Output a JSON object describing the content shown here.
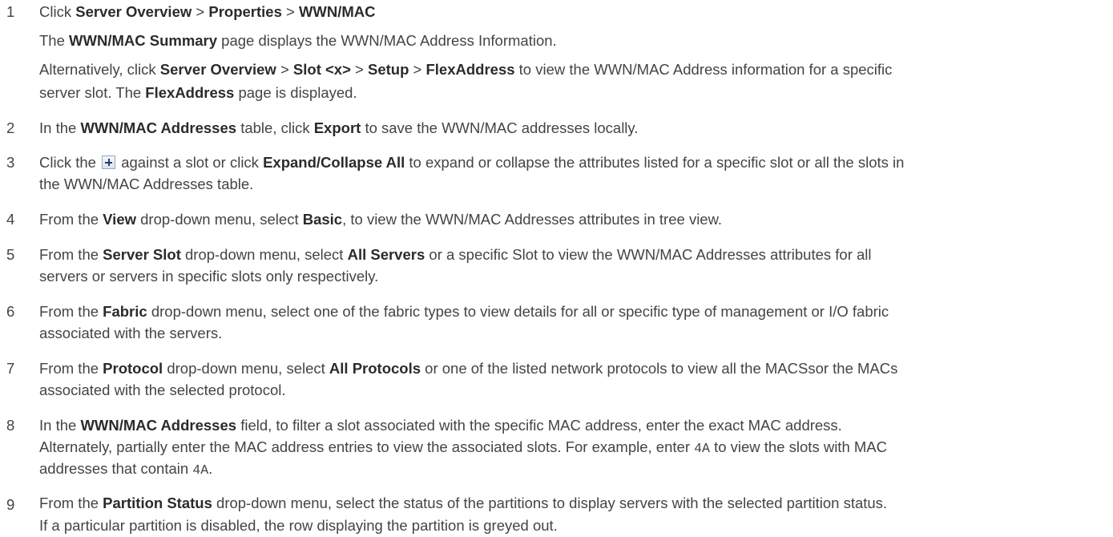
{
  "steps": [
    {
      "num": "1",
      "lines": [
        [
          {
            "t": "Click "
          },
          {
            "b": "Server Overview"
          },
          {
            "t": " > "
          },
          {
            "b": "Properties"
          },
          {
            "t": " > "
          },
          {
            "b": "WWN/MAC"
          }
        ],
        [
          {
            "t": "The "
          },
          {
            "b": "WWN/MAC Summary"
          },
          {
            "t": " page displays the WWN/MAC Address Information."
          }
        ],
        [
          {
            "t": "Alternatively, click "
          },
          {
            "b": "Server Overview"
          },
          {
            "t": " > "
          },
          {
            "b": "Slot <x>"
          },
          {
            "t": " > "
          },
          {
            "b": "Setup"
          },
          {
            "t": " > "
          },
          {
            "b": "FlexAddress"
          },
          {
            "t": " to view the WWN/MAC Address information for a specific"
          }
        ],
        [
          {
            "t": "server slot. The "
          },
          {
            "b": "FlexAddress"
          },
          {
            "t": " page is displayed."
          }
        ]
      ]
    },
    {
      "num": "2",
      "lines": [
        [
          {
            "t": "In the "
          },
          {
            "b": "WWN/MAC Addresses"
          },
          {
            "t": " table, click "
          },
          {
            "b": "Export"
          },
          {
            "t": " to save the WWN/MAC addresses locally."
          }
        ]
      ]
    },
    {
      "num": "3",
      "lines": [
        [
          {
            "t": "Click the "
          },
          {
            "icon": "plus-icon"
          },
          {
            "t": " against a slot or click "
          },
          {
            "b": "Expand/Collapse All"
          },
          {
            "t": " to expand or collapse the attributes listed for a specific slot or all the slots in"
          }
        ],
        [
          {
            "t": "the WWN/MAC Addresses table."
          }
        ]
      ]
    },
    {
      "num": "4",
      "lines": [
        [
          {
            "t": "From the "
          },
          {
            "b": "View"
          },
          {
            "t": " drop-down menu, select "
          },
          {
            "b": "Basic"
          },
          {
            "t": ", to view the WWN/MAC Addresses attributes in tree view."
          }
        ]
      ]
    },
    {
      "num": "5",
      "lines": [
        [
          {
            "t": "From the "
          },
          {
            "b": "Server Slot"
          },
          {
            "t": " drop-down menu, select "
          },
          {
            "b": "All Servers"
          },
          {
            "t": " or a specific Slot to view the WWN/MAC Addresses attributes for all"
          }
        ],
        [
          {
            "t": "servers or servers in specific slots only respectively."
          }
        ]
      ]
    },
    {
      "num": "6",
      "lines": [
        [
          {
            "t": "From the "
          },
          {
            "b": "Fabric"
          },
          {
            "t": " drop-down menu, select one of the fabric types to view details for all or specific type of management or I/O fabric"
          }
        ],
        [
          {
            "t": "associated with the servers."
          }
        ]
      ]
    },
    {
      "num": "7",
      "lines": [
        [
          {
            "t": "From the "
          },
          {
            "b": "Protocol"
          },
          {
            "t": " drop-down menu, select "
          },
          {
            "b": "All Protocols"
          },
          {
            "t": " or one of the listed network protocols to view all the MACSsor the MACs"
          }
        ],
        [
          {
            "t": "associated with the selected protocol."
          }
        ]
      ]
    },
    {
      "num": "8",
      "lines": [
        [
          {
            "t": "In the "
          },
          {
            "b": "WWN/MAC Addresses"
          },
          {
            "t": " field, to filter a slot associated with the specific MAC address, enter the exact MAC address."
          }
        ],
        [
          {
            "t": "Alternately, partially enter the MAC address entries to view the associated slots. For example, enter "
          },
          {
            "c": "4A"
          },
          {
            "t": " to view the slots with MAC"
          }
        ],
        [
          {
            "t": "addresses that contain "
          },
          {
            "c": "4A"
          },
          {
            "t": "."
          }
        ]
      ]
    },
    {
      "num": "9",
      "lines": [
        [
          {
            "t": "From the "
          },
          {
            "b": "Partition Status"
          },
          {
            "t": " drop-down menu, select the status of the partitions to display servers with the selected partition status."
          }
        ],
        [
          {
            "t": "If a particular partition is disabled, the row displaying the partition is greyed out."
          }
        ]
      ]
    }
  ]
}
